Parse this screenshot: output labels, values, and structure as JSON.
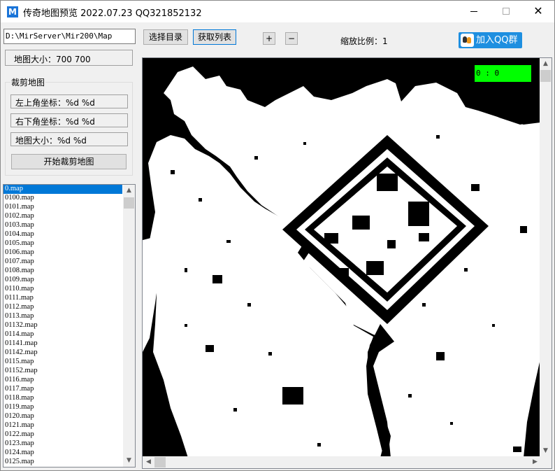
{
  "window": {
    "title": "传奇地图预览 2022.07.23 QQ321852132",
    "app_icon_text": "M",
    "minimize": "minimize",
    "maximize": "maximize",
    "close": "✕"
  },
  "toolbar": {
    "path_value": "D:\\MirServer\\Mir200\\Map",
    "select_dir_label": "选择目录",
    "get_list_label": "获取列表",
    "zoom_in_label": "+",
    "zoom_out_label": "−",
    "zoom_text": "缩放比例：1",
    "qq_label": "加入QQ群"
  },
  "info": {
    "map_size_text": "地图大小：700  700"
  },
  "crop": {
    "group_title": "裁剪地图",
    "top_left_text": "左上角坐标：%d  %d",
    "bottom_right_text": "右下角坐标：%d  %d",
    "size_text": "地图大小：%d  %d",
    "start_button": "开始裁剪地图"
  },
  "file_list": {
    "selected_index": 0,
    "items": [
      "0.map",
      "0100.map",
      "0101.map",
      "0102.map",
      "0103.map",
      "0104.map",
      "0105.map",
      "0106.map",
      "0107.map",
      "0108.map",
      "0109.map",
      "0110.map",
      "0111.map",
      "0112.map",
      "0113.map",
      "01132.map",
      "0114.map",
      "01141.map",
      "01142.map",
      "0115.map",
      "01152.map",
      "0116.map",
      "0117.map",
      "0118.map",
      "0119.map",
      "0120.map",
      "0121.map",
      "0122.map",
      "0123.map",
      "0124.map",
      "0125.map"
    ]
  },
  "map_view": {
    "coord_text": "0 : 0",
    "coord_bg": "#00ff00"
  },
  "colors": {
    "accent": "#0078d7",
    "qq_button": "#1e8fe0"
  }
}
